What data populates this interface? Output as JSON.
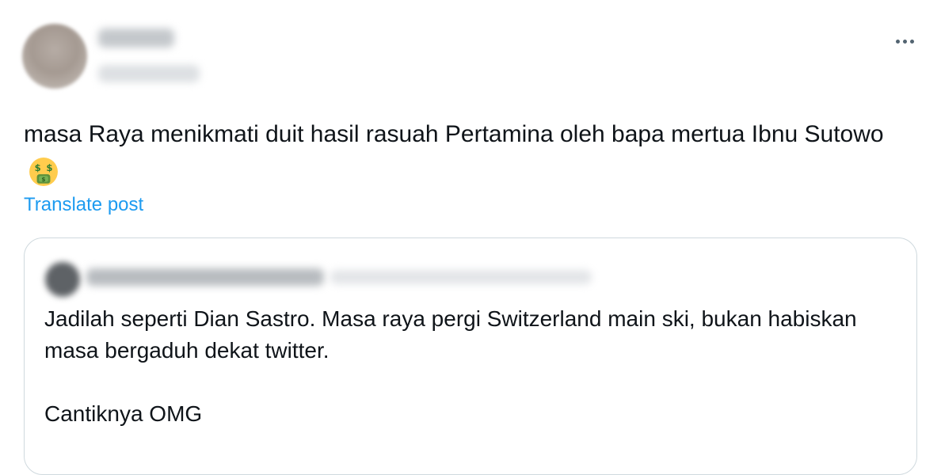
{
  "post": {
    "text": "masa Raya menikmati duit hasil rasuah Pertamina oleh bapa mertua Ibnu Sutowo",
    "emoji": "money-mouth-face",
    "translate_label": "Translate post"
  },
  "quoted_post": {
    "line1": "Jadilah seperti Dian Sastro. Masa raya pergi Switzerland main ski, bukan habiskan masa bergaduh dekat twitter.",
    "line2": "Cantiknya OMG"
  },
  "icons": {
    "more": "more-horizontal-icon"
  }
}
